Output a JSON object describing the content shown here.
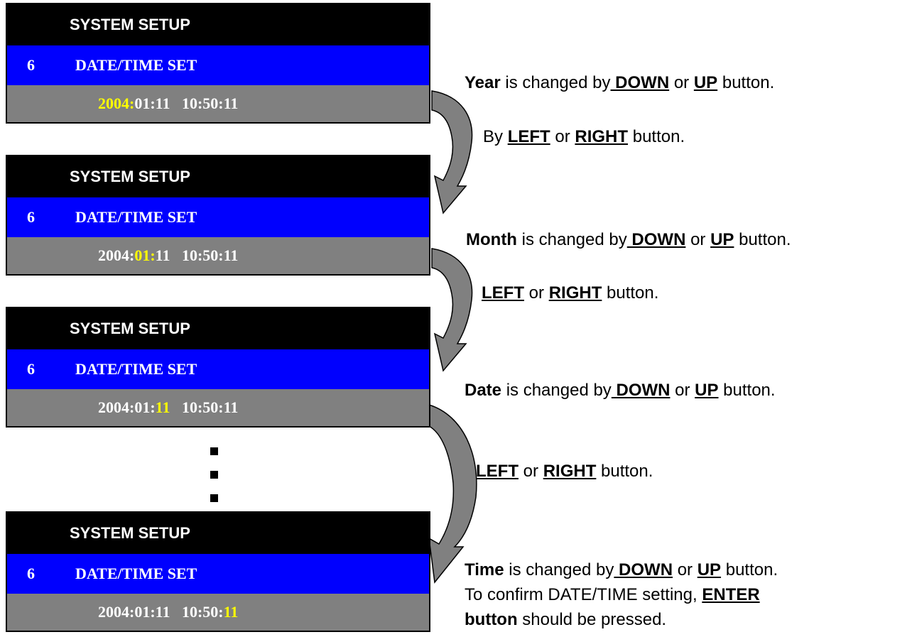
{
  "panels": [
    {
      "header": "SYSTEM SETUP",
      "menu_number": "6",
      "menu_label": "DATE/TIME SET",
      "value_parts": [
        "",
        "2004:",
        "01:11   10:50:11"
      ]
    },
    {
      "header": "SYSTEM SETUP",
      "menu_number": "6",
      "menu_label": "DATE/TIME SET",
      "value_parts": [
        "2004:",
        "01:",
        "11   10:50:11"
      ]
    },
    {
      "header": "SYSTEM SETUP",
      "menu_number": "6",
      "menu_label": "DATE/TIME SET",
      "value_parts": [
        "2004:01:",
        "11",
        "   10:50:11"
      ]
    },
    {
      "header": "SYSTEM SETUP",
      "menu_number": "6",
      "menu_label": "DATE/TIME SET",
      "value_parts": [
        "2004:01:11   10:50:",
        "11",
        ""
      ]
    }
  ],
  "instructions": {
    "year": {
      "field": "Year",
      "text1": " is changed by",
      "key1": " DOWN",
      "text2": " or ",
      "key2": "UP",
      "text3": " button."
    },
    "move1": {
      "text1": "By ",
      "key1": "LEFT",
      "text2": " or ",
      "key2": "RIGHT",
      "text3": " button."
    },
    "month": {
      "field": "Month",
      "text1": " is changed by",
      "key1": " DOWN",
      "text2": " or ",
      "key2": "UP",
      "text3": " button."
    },
    "move2": {
      "key1": "LEFT",
      "text2": " or ",
      "key2": "RIGHT",
      "text3": " button."
    },
    "date": {
      "field": "Date",
      "text1": " is changed by",
      "key1": " DOWN",
      "text2": " or ",
      "key2": "UP",
      "text3": " button."
    },
    "move3": {
      "key1": "LEFT",
      "text2": " or ",
      "key2": "RIGHT",
      "text3": " button."
    },
    "time": {
      "field": "Time",
      "text1": " is changed by",
      "key1": " DOWN",
      "text2": " or ",
      "key2": "UP",
      "text3": " button."
    },
    "confirm": {
      "text1": "To confirm DATE/TIME setting, ",
      "key1": "ENTER"
    },
    "confirm2": {
      "bold1": "button",
      "text1": " should be pressed."
    }
  },
  "colors": {
    "menu_bar": "#0000fe",
    "value_bar": "#808080",
    "highlight": "#ffff00",
    "arrow": "#808080"
  }
}
